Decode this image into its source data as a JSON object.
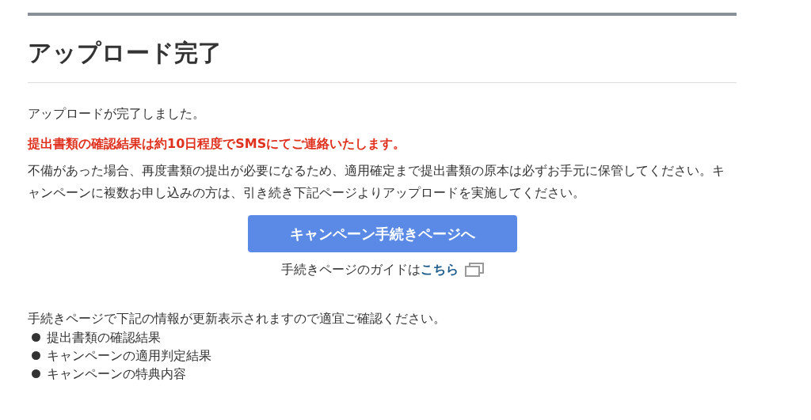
{
  "title": "アップロード完了",
  "message": "アップロードが完了しました。",
  "notice": "提出書類の確認結果は約10日程度でSMSにてご連絡いたします。",
  "description": "不備があった場合、再度書類の提出が必要になるため、適用確定まで提出書類の原本は必ずお手元に保管してください。キャンペーンに複数お申し込みの方は、引き続き下記ページよりアップロードを実施してください。",
  "button": {
    "label": "キャンペーン手続きページへ"
  },
  "guide": {
    "text": "手続きページのガイドは",
    "link": "こちら"
  },
  "info_intro": "手続きページで下記の情報が更新表示されますので適宜ご確認ください。",
  "info_items": [
    "提出書類の確認結果",
    "キャンペーンの適用判定結果",
    "キャンペーンの特典内容"
  ]
}
